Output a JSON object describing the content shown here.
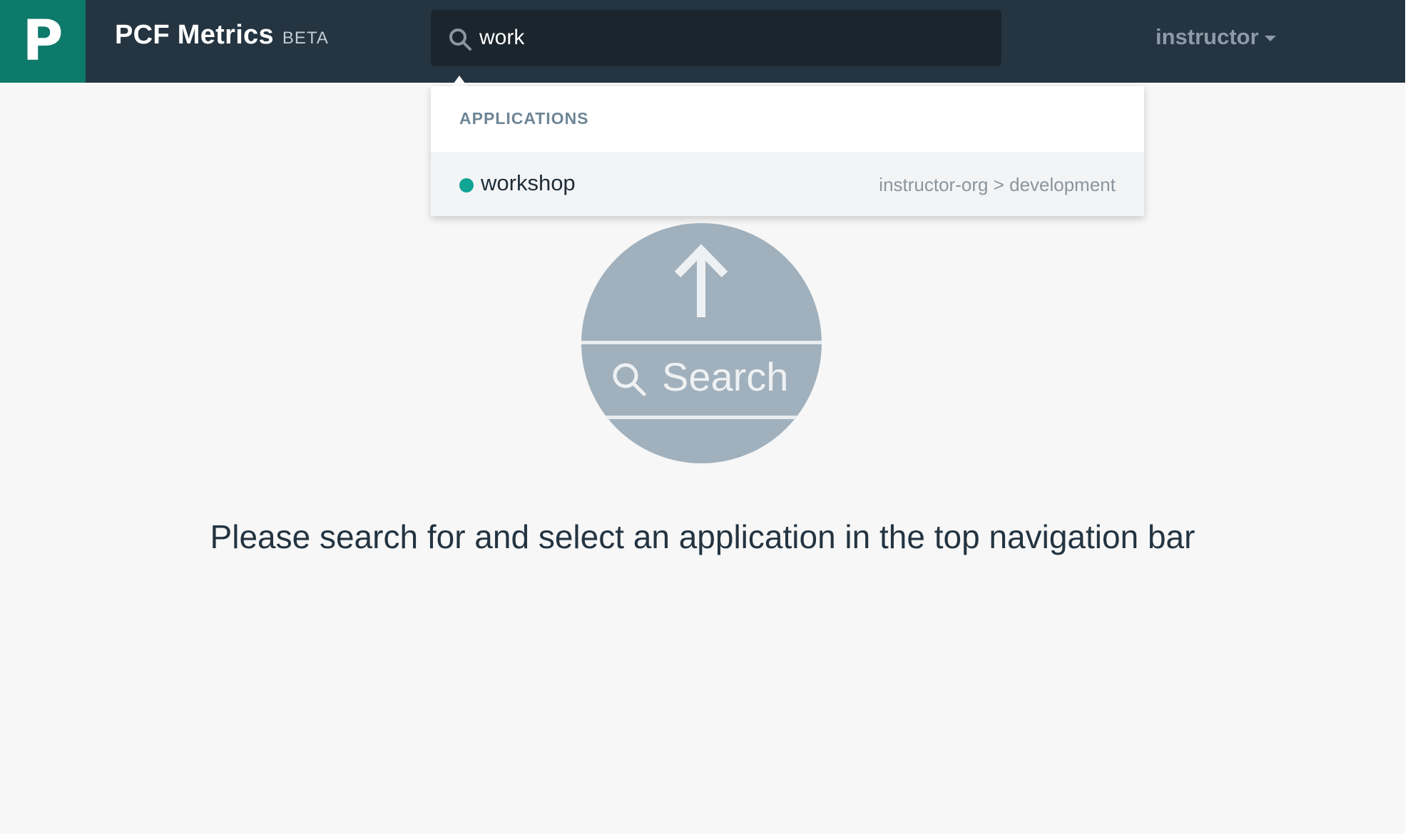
{
  "brand": {
    "logo_letter": "P",
    "name": "PCF Metrics",
    "tag": "BETA",
    "logo_color": "#0d7a6b"
  },
  "navbar": {
    "background": "#243441"
  },
  "search": {
    "value": "work",
    "icon": "search-icon"
  },
  "user_menu": {
    "label": "instructor",
    "icon": "caret-down-icon"
  },
  "dropdown": {
    "section_header": "APPLICATIONS",
    "items": [
      {
        "name": "workshop",
        "status_color": "#11a394",
        "org": "instructor-org",
        "separator": ">",
        "space": "development"
      }
    ]
  },
  "illustration": {
    "icon": "arrow-up-icon",
    "search_icon": "search-icon",
    "label": "Search"
  },
  "main": {
    "hint": "Please search for and select an application in the top navigation bar"
  }
}
